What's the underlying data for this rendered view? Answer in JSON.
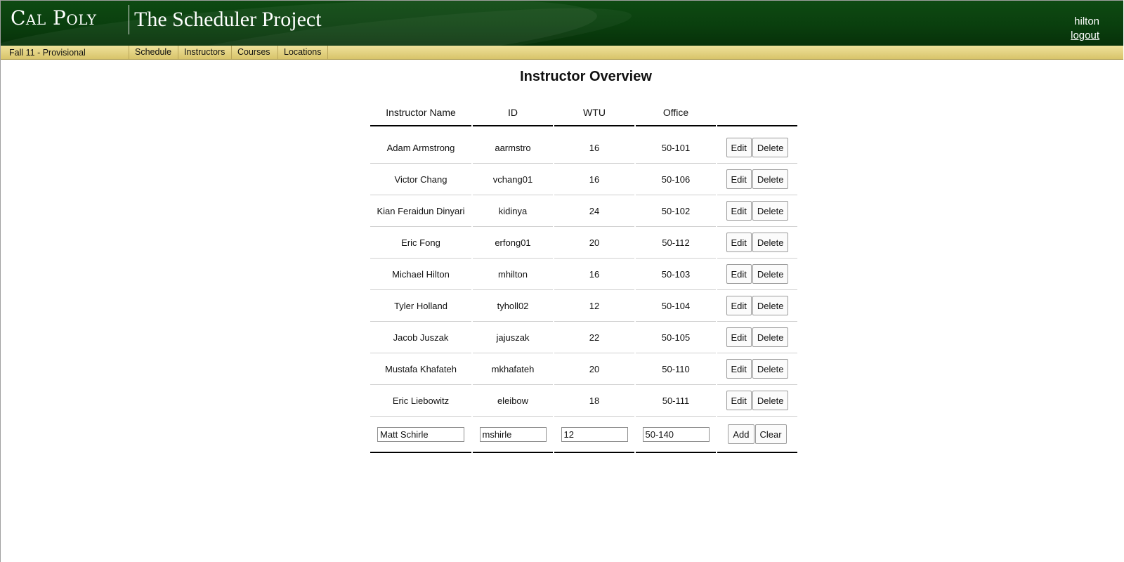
{
  "header": {
    "logo_text": "Cal Poly",
    "app_title": "The Scheduler Project",
    "username": "hilton",
    "logout_label": "logout"
  },
  "navbar": {
    "term": "Fall 11 - Provisional",
    "items": [
      {
        "label": "Schedule"
      },
      {
        "label": "Instructors"
      },
      {
        "label": "Courses"
      },
      {
        "label": "Locations"
      }
    ]
  },
  "main": {
    "title": "Instructor Overview",
    "columns": [
      "Instructor Name",
      "ID",
      "WTU",
      "Office",
      ""
    ],
    "rows": [
      {
        "name": "Adam Armstrong",
        "id": "aarmstro",
        "wtu": "16",
        "office": "50-101"
      },
      {
        "name": "Victor Chang",
        "id": "vchang01",
        "wtu": "16",
        "office": "50-106"
      },
      {
        "name": "Kian Feraidun Dinyari",
        "id": "kidinya",
        "wtu": "24",
        "office": "50-102"
      },
      {
        "name": "Eric Fong",
        "id": "erfong01",
        "wtu": "20",
        "office": "50-112"
      },
      {
        "name": "Michael Hilton",
        "id": "mhilton",
        "wtu": "16",
        "office": "50-103"
      },
      {
        "name": "Tyler Holland",
        "id": "tyholl02",
        "wtu": "12",
        "office": "50-104"
      },
      {
        "name": "Jacob Juszak",
        "id": "jajuszak",
        "wtu": "22",
        "office": "50-105"
      },
      {
        "name": "Mustafa Khafateh",
        "id": "mkhafateh",
        "wtu": "20",
        "office": "50-110"
      },
      {
        "name": "Eric Liebowitz",
        "id": "eleibow",
        "wtu": "18",
        "office": "50-111"
      }
    ],
    "row_actions": {
      "edit_label": "Edit",
      "delete_label": "Delete"
    },
    "new_entry": {
      "name_value": "Matt Schirle",
      "id_value": "mshirle",
      "wtu_value": "12",
      "office_value": "50-140",
      "add_label": "Add",
      "clear_label": "Clear"
    }
  },
  "colors": {
    "header_green": "#0a3f0e",
    "nav_gold": "#e3d27f"
  }
}
